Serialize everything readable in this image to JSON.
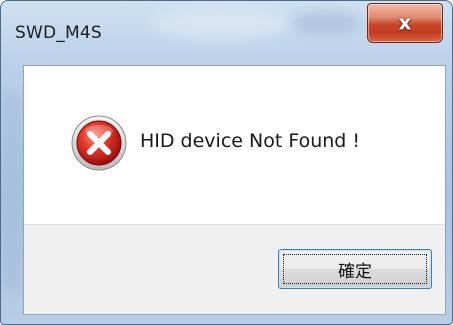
{
  "window": {
    "title": "SWD_M4S"
  },
  "dialog": {
    "message": "HID device Not Found !",
    "icon": "error-icon",
    "ok_label": "確定",
    "close_icon_glyph": "x"
  },
  "colors": {
    "close_button_red": "#c7452a",
    "error_icon_red": "#cc1f1f",
    "frame_blue": "#bcd2ea",
    "button_panel_gray": "#f0f0f0"
  }
}
